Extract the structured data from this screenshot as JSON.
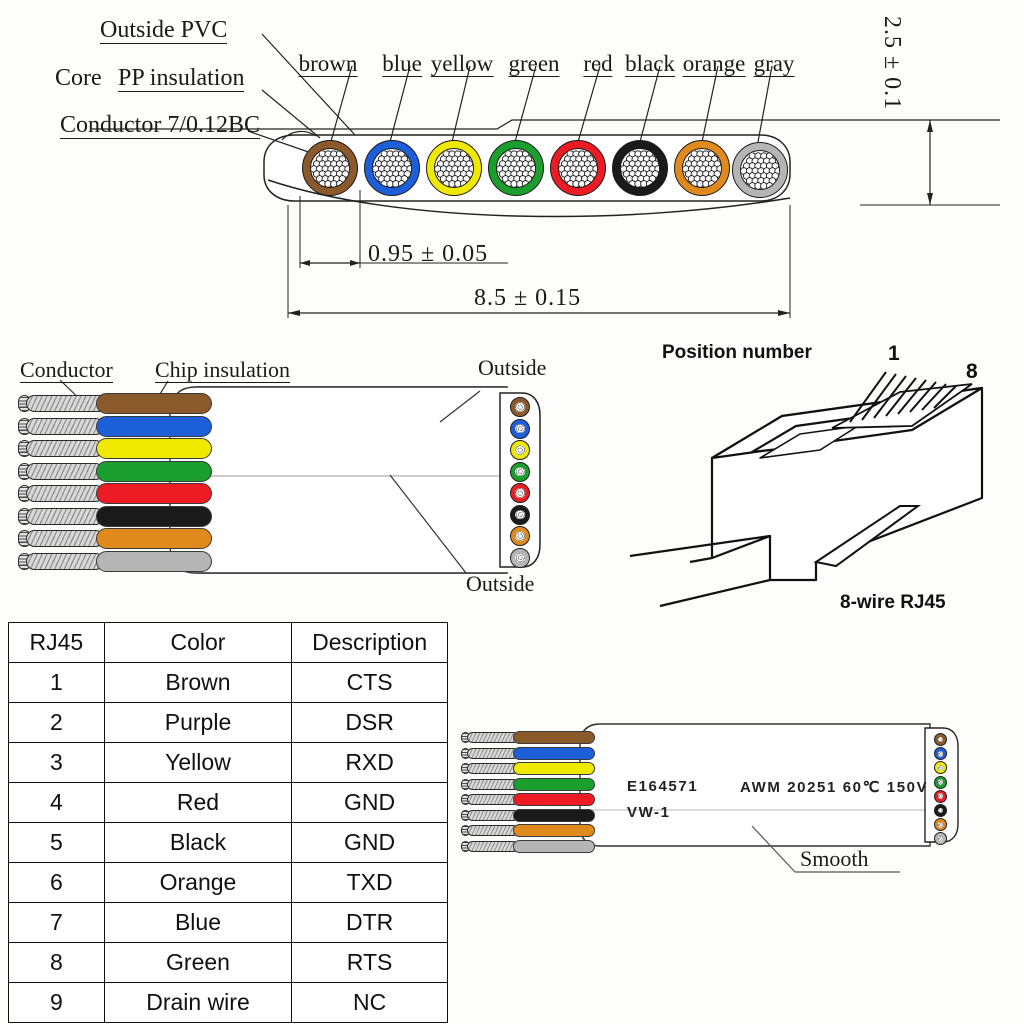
{
  "top_section": {
    "labels": [
      {
        "text": "Outside PVC",
        "name": "label-outside-pvc"
      },
      {
        "text": "Core PP insulation",
        "name": "label-core-pp-insulation"
      },
      {
        "text": "Conductor 7/0.12BC",
        "name": "label-conductor-7-0-12bc"
      }
    ],
    "core_prefix": "Core",
    "wire_labels": [
      "brown",
      "blue",
      "yellow",
      "green",
      "red",
      "black",
      "orange",
      "gray"
    ],
    "dimensions": {
      "pitch": "0.95 ± 0.05",
      "width": "8.5 ± 0.15",
      "thickness": "2.5 ± 0.1"
    },
    "wire_colors": {
      "brown": "#8B5A2B",
      "blue": "#1C5FD9",
      "yellow": "#EFE900",
      "green": "#1A9E2E",
      "red": "#ED1C24",
      "black": "#1a1a1a",
      "orange": "#E08A1E",
      "gray": "#B5B5B5"
    }
  },
  "mid_cable": {
    "labels": {
      "conductor": "Conductor",
      "chip_insulation": "Chip insulation",
      "outside_top": "Outside",
      "outside_bottom": "Outside"
    },
    "wire_order": [
      "brown",
      "blue",
      "yellow",
      "green",
      "red",
      "black",
      "orange",
      "gray"
    ]
  },
  "rj45": {
    "title": "Position number",
    "pin_first": "1",
    "pin_last": "8",
    "caption": "8-wire RJ45"
  },
  "pin_table": {
    "headers": [
      "RJ45",
      "Color",
      "Description"
    ],
    "rows": [
      [
        "1",
        "Brown",
        "CTS"
      ],
      [
        "2",
        "Purple",
        "DSR"
      ],
      [
        "3",
        "Yellow",
        "RXD"
      ],
      [
        "4",
        "Red",
        "GND"
      ],
      [
        "5",
        "Black",
        "GND"
      ],
      [
        "6",
        "Orange",
        "TXD"
      ],
      [
        "7",
        "Blue",
        "DTR"
      ],
      [
        "8",
        "Green",
        "RTS"
      ],
      [
        "9",
        "Drain wire",
        "NC"
      ]
    ]
  },
  "br_cable": {
    "print_line1_left": "E164571",
    "print_line2_left": "VW-1",
    "print_line1_right": "AWM  20251  60℃  150V",
    "label_smooth": "Smooth",
    "wire_order": [
      "brown",
      "blue",
      "yellow",
      "green",
      "red",
      "black",
      "orange",
      "gray"
    ]
  }
}
